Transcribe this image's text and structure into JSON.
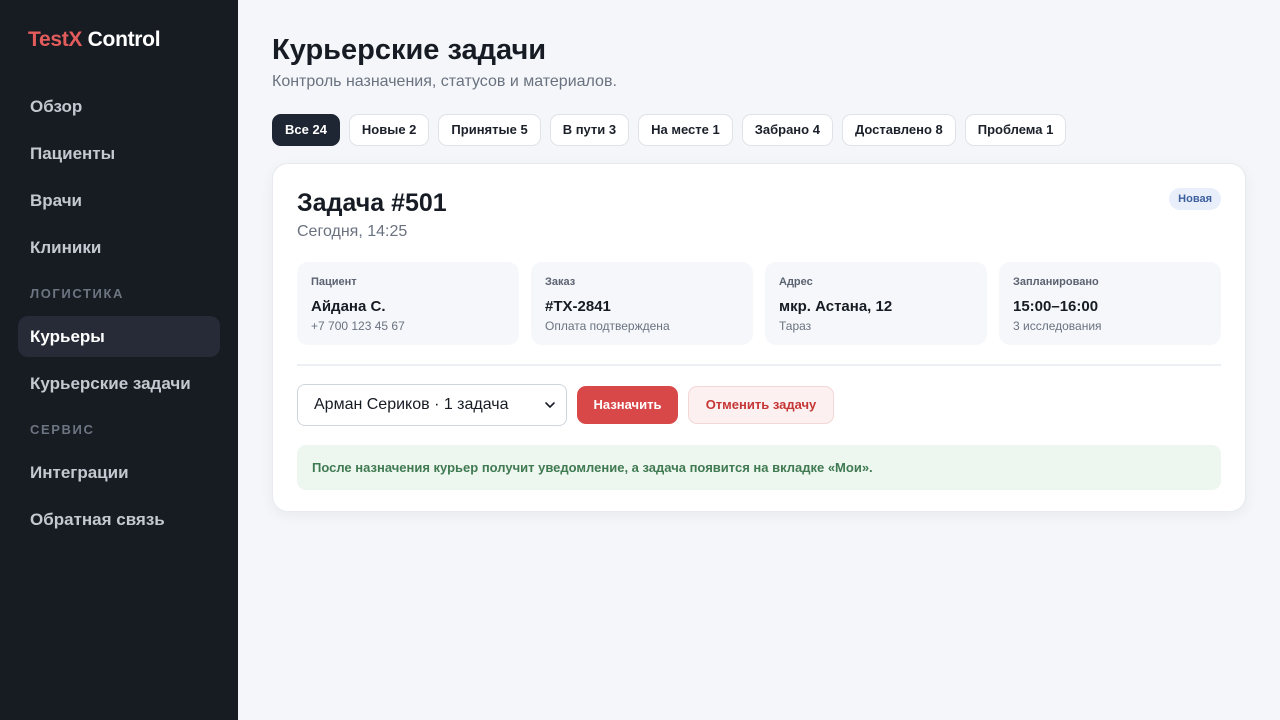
{
  "app": {
    "logo_part1": "TestX",
    "logo_part2": " Control"
  },
  "sidebar": {
    "items_top": [
      "Обзор",
      "Пациенты",
      "Врачи",
      "Клиники"
    ],
    "section_logistics": "ЛОГИСТИКА",
    "logistics_items": [
      "Курьеры",
      "Курьерские задачи"
    ],
    "section_service": "СЕРВИС",
    "service_items": [
      "Интеграции",
      "Обратная связь"
    ],
    "active_item": "Курьеры"
  },
  "page": {
    "title": "Курьерские задачи",
    "subtitle": "Контроль назначения, статусов и материалов."
  },
  "tabs": [
    "Все 24",
    "Новые 2",
    "Принятые 5",
    "В пути 3",
    "На месте 1",
    "Забрано 4",
    "Доставлено 8",
    "Проблема 1"
  ],
  "task": {
    "title": "Задача #501",
    "time": "Сегодня, 14:25",
    "status": "Новая",
    "info": [
      {
        "label": "Пациент",
        "value": "Айдана С.",
        "sub": "+7 700 123 45 67"
      },
      {
        "label": "Заказ",
        "value": "#TX-2841",
        "sub": "Оплата подтверждена"
      },
      {
        "label": "Адрес",
        "value": "мкр. Астана, 12",
        "sub": "Тараз"
      },
      {
        "label": "Запланировано",
        "value": "15:00–16:00",
        "sub": "3 исследования"
      }
    ],
    "courier_select": "Арман Сериков · 1 задача",
    "assign_label": "Назначить",
    "cancel_label": "Отменить задачу",
    "notice": "После назначения курьер получит уведомление, а задача появится на вкладке «Мои»."
  },
  "colors": {
    "sidebar_bg": "#171b22",
    "accent_red": "#d94849",
    "logo_red": "#e25c5c",
    "notice_green": "#3f7a51"
  }
}
